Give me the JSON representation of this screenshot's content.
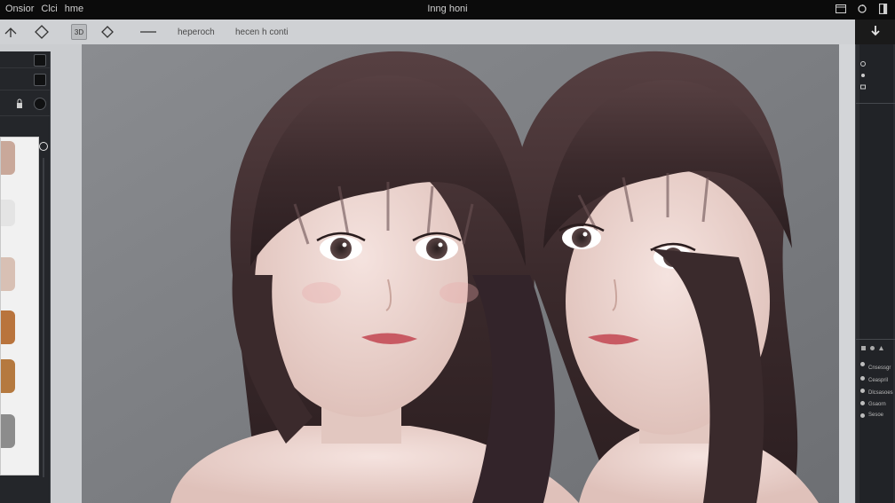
{
  "window": {
    "menu": [
      "Onsior",
      "Clci",
      "hme"
    ],
    "title": "Inng honi"
  },
  "toolbar": {
    "badge_3d": "3D",
    "text_1": "heperoch",
    "text_2": "hecen h conti"
  },
  "right_panel": {
    "labels": [
      "Cnsessgr",
      "Ceaspril",
      "Dlcsasoes",
      "Gsaorn",
      "Sesoe"
    ]
  },
  "icons": {
    "window_controls": [
      "window-icon",
      "refresh-icon",
      "panel-icon"
    ],
    "tools": [
      "pen-tool-icon",
      "diamond-select-icon",
      "3d-icon",
      "diamond-small-icon",
      "line-tool-icon"
    ],
    "right_top": "arrow-down-icon"
  },
  "colors": {
    "chrome_dark": "#121212",
    "toolbar": "#cfd1d4",
    "canvas": "#7a7c80",
    "hair": "#3d2b2c",
    "skin": "#ecd6d1",
    "lips": "#c85a63"
  }
}
